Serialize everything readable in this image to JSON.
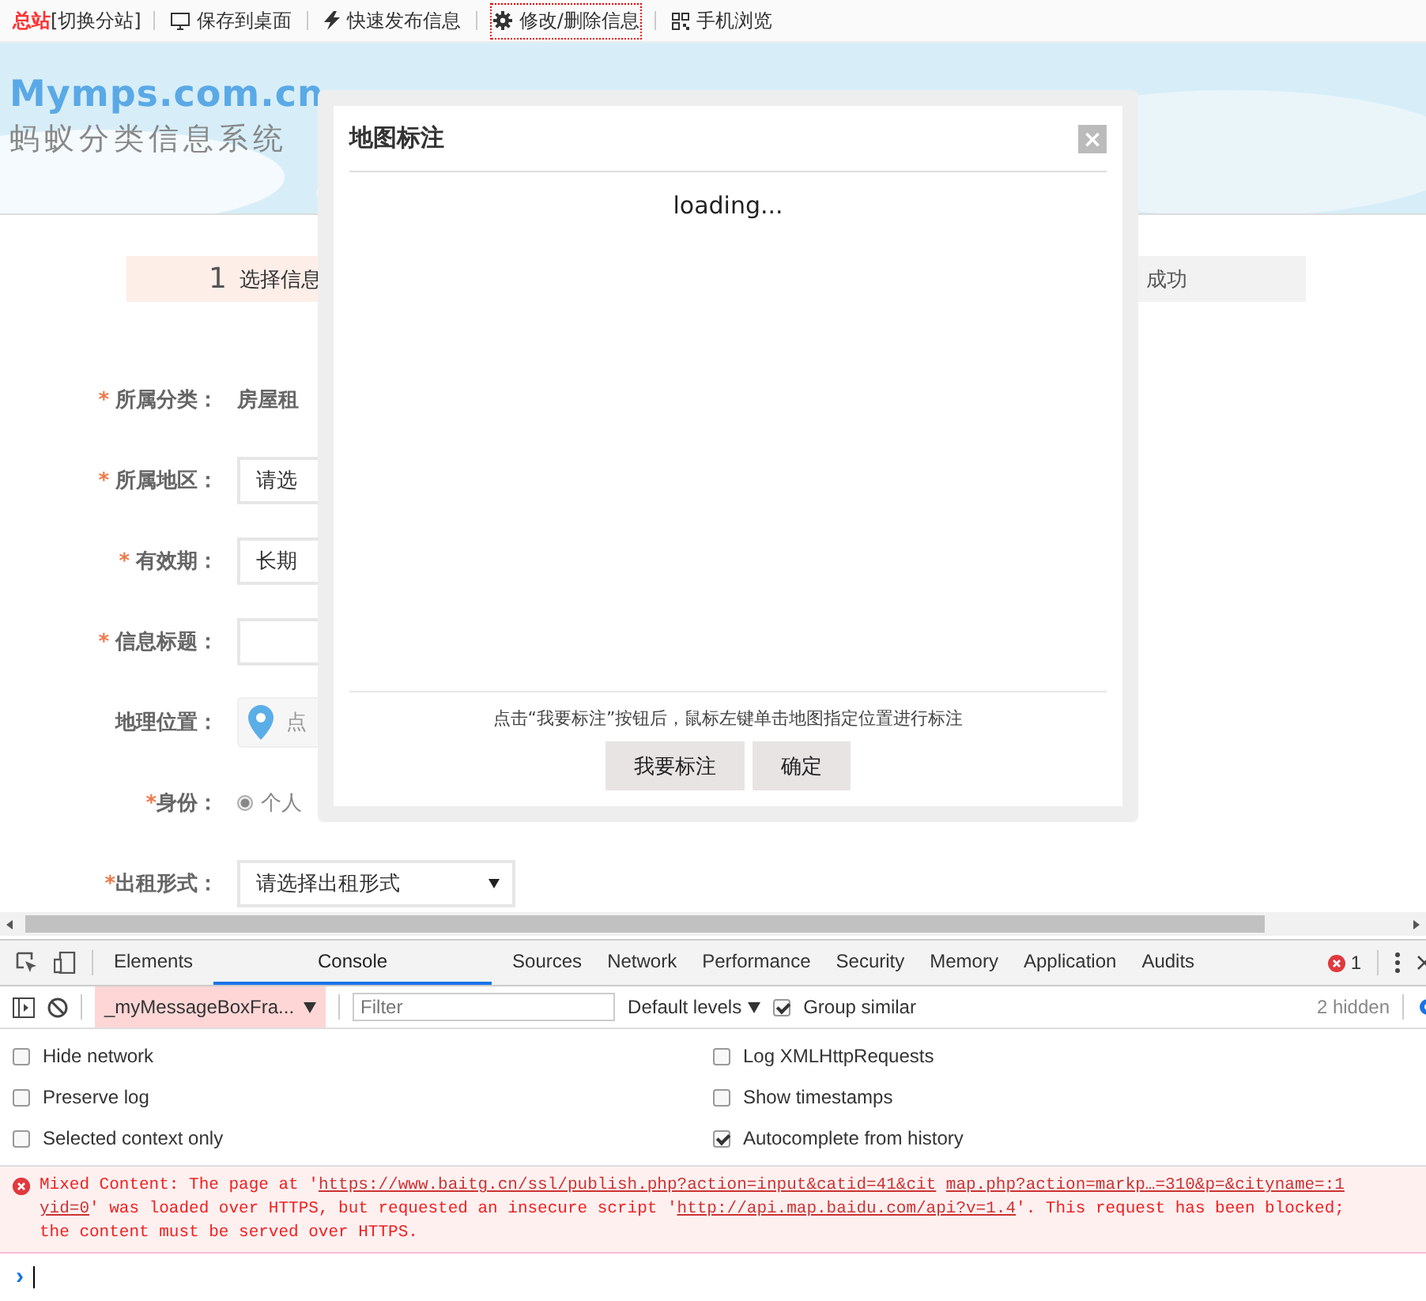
{
  "topbar": {
    "site": "总站",
    "switch": "[切换分站]",
    "links": [
      {
        "kind": "monitor",
        "label": "保存到桌面",
        "focused": false
      },
      {
        "kind": "bolt",
        "label": "快速发布信息",
        "focused": false
      },
      {
        "kind": "gear",
        "label": "修改/删除信息",
        "focused": true
      },
      {
        "kind": "qr",
        "label": "手机浏览",
        "focused": false
      }
    ]
  },
  "header": {
    "logo": "Mymps.com.cn",
    "subtitle": "蚂蚁分类信息系统"
  },
  "steps": {
    "number": "1",
    "first": "选择信息",
    "last": "成功"
  },
  "form": [
    {
      "mark": "*",
      "label": "所属分类：",
      "kind": "text",
      "value": "房屋租"
    },
    {
      "mark": "*",
      "label": "所属地区：",
      "kind": "field",
      "value": "请选"
    },
    {
      "mark": "*",
      "label": "有效期：",
      "kind": "field",
      "value": "长期"
    },
    {
      "mark": "*",
      "label": "信息标题：",
      "kind": "field"
    },
    {
      "label": "地理位置：",
      "kind": "location",
      "value": "点"
    },
    {
      "mark": "*",
      "label": "身份：",
      "kind": "radio",
      "value": "个人",
      "selected": true
    },
    {
      "mark": "*",
      "label": "出租形式：",
      "kind": "select",
      "value": "请选择出租形式"
    }
  ],
  "dialog": {
    "title": "地图标注",
    "close": "×",
    "status": "loading...",
    "hint": "点击“我要标注”按钮后，鼠标左键单击地图指定位置进行标注",
    "buttons": [
      "我要标注",
      "确定"
    ]
  },
  "devtools": {
    "tabs": [
      {
        "label": "Elements",
        "selected": false
      },
      {
        "label": "Console",
        "selected": true
      },
      {
        "label": "Sources",
        "selected": false
      },
      {
        "label": "Network",
        "selected": false
      },
      {
        "label": "Performance",
        "selected": false
      },
      {
        "label": "Security",
        "selected": false
      },
      {
        "label": "Memory",
        "selected": false
      },
      {
        "label": "Application",
        "selected": false
      },
      {
        "label": "Audits",
        "selected": false
      }
    ],
    "error_count": "1",
    "context": "_myMessageBoxFra...",
    "filter_placeholder": "Filter",
    "levels": "Default levels",
    "group_similar": {
      "label": "Group similar",
      "checked": true
    },
    "hidden": "2 hidden",
    "settings_left": [
      {
        "label": "Hide network",
        "checked": false
      },
      {
        "label": "Preserve log",
        "checked": false
      },
      {
        "label": "Selected context only",
        "checked": false
      }
    ],
    "settings_right": [
      {
        "label": "Log XMLHttpRequests",
        "checked": false
      },
      {
        "label": "Show timestamps",
        "checked": false
      },
      {
        "label": "Autocomplete from history",
        "checked": true
      }
    ],
    "error_lines": [
      [
        {
          "text": "Mixed Content: The page at '",
          "link": false
        },
        {
          "text": "https://www.baitg.cn/ssl/publish.php?action=input&catid=41&cit",
          "link": true
        },
        {
          "text": "map.php?action=markp…=310&p=&cityname=:1",
          "link": true
        }
      ],
      [
        {
          "text": "yid=0",
          "link": true
        },
        {
          "text": "' was loaded over HTTPS, but requested an insecure script '",
          "link": false
        },
        {
          "text": "http://api.map.baidu.com/api?v=1.4",
          "link": true
        },
        {
          "text": "'. This request has been blocked;",
          "link": false
        }
      ],
      [
        {
          "text": "the content must be served over HTTPS.",
          "link": false
        }
      ]
    ],
    "prompt": "›"
  }
}
